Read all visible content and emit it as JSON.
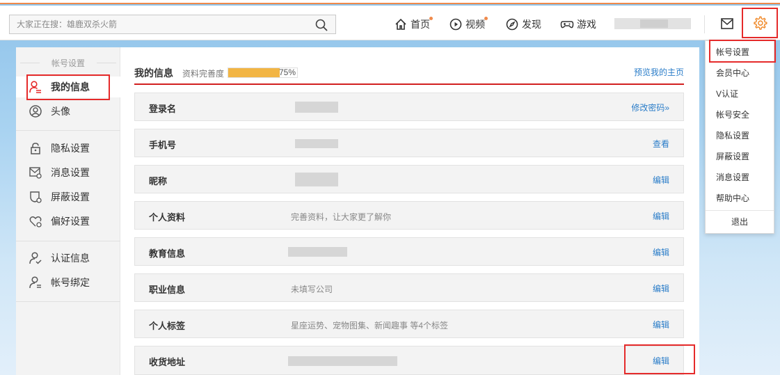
{
  "search": {
    "placeholder": "大家正在搜：雄鹿双杀火箭"
  },
  "nav": {
    "home": "首页",
    "video": "视频",
    "discover": "发现",
    "games": "游戏"
  },
  "sidebar": {
    "section_title": "帐号设置",
    "items": [
      {
        "label": "我的信息",
        "icon": "user-card-icon",
        "active": true
      },
      {
        "label": "头像",
        "icon": "avatar-icon"
      },
      {
        "label": "隐私设置",
        "icon": "lock-icon"
      },
      {
        "label": "消息设置",
        "icon": "message-settings-icon"
      },
      {
        "label": "屏蔽设置",
        "icon": "block-settings-icon"
      },
      {
        "label": "偏好设置",
        "icon": "heart-settings-icon"
      },
      {
        "label": "认证信息",
        "icon": "verified-user-icon"
      },
      {
        "label": "帐号绑定",
        "icon": "account-link-icon"
      }
    ]
  },
  "content": {
    "title": "我的信息",
    "completeness_label": "资料完善度",
    "completeness_value": "75%",
    "completeness_fraction": 0.75,
    "preview_link": "预览我的主页",
    "rows": [
      {
        "label": "登录名",
        "value": "",
        "action": "修改密码»"
      },
      {
        "label": "手机号",
        "value": "",
        "action": "查看"
      },
      {
        "label": "昵称",
        "value": "",
        "action": "编辑"
      },
      {
        "label": "个人资料",
        "value": "完善资料，让大家更了解你",
        "action": "编辑"
      },
      {
        "label": "教育信息",
        "value": "",
        "action": "编辑"
      },
      {
        "label": "职业信息",
        "value": "未填写公司",
        "action": "编辑"
      },
      {
        "label": "个人标签",
        "value": "星座运势、宠物图集、新闻趣事 等4个标签",
        "action": "编辑"
      },
      {
        "label": "收货地址",
        "value": "",
        "action": "编辑"
      }
    ]
  },
  "dropdown": {
    "items": [
      "帐号设置",
      "会员中心",
      "V认证",
      "帐号安全",
      "隐私设置",
      "屏蔽设置",
      "消息设置",
      "帮助中心"
    ],
    "logout": "退出"
  },
  "colors": {
    "accent_red": "#e52a2a",
    "link_blue": "#2c7ec9",
    "progress": "#f2b544",
    "notify_orange": "#f08a4b"
  }
}
